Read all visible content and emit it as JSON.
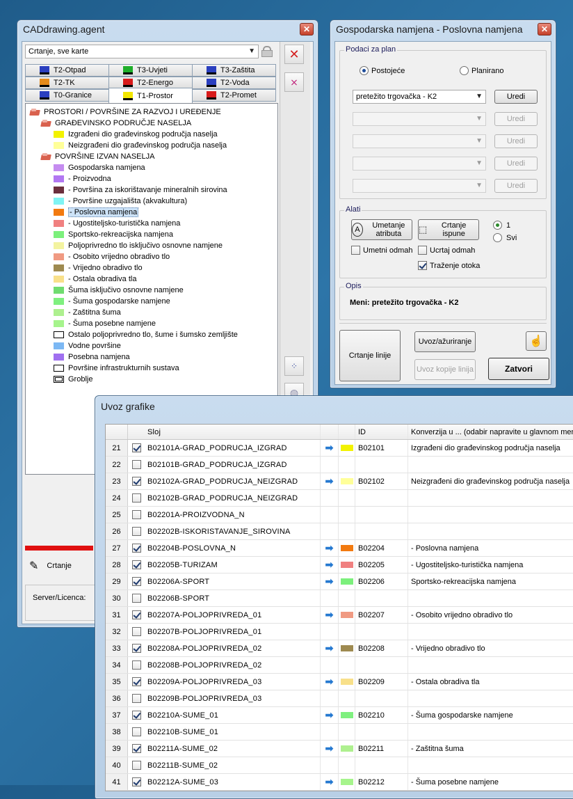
{
  "cad": {
    "title": "CADdrawing.agent",
    "dropdown_value": "Crtanje, sve karte",
    "tabs_row1": [
      {
        "label": "T2-Otpad",
        "color": "#2b3fbf"
      },
      {
        "label": "T3-Uvjeti",
        "color": "#1fae2a"
      },
      {
        "label": "T3-Zaštita",
        "color": "#2b3fbf"
      }
    ],
    "tabs_row2": [
      {
        "label": "T2-TK",
        "color": "#e58b1c"
      },
      {
        "label": "T2-Energo",
        "color": "#d81b1b"
      },
      {
        "label": "T2-Voda",
        "color": "#2b3fbf"
      }
    ],
    "tabs_row3": [
      {
        "label": "T0-Granice",
        "color": "#2b3fbf"
      },
      {
        "label": "T1-Prostor",
        "color": "#f2e600"
      },
      {
        "label": "T2-Promet",
        "color": "#d81b1b"
      }
    ],
    "tree": [
      {
        "level": 0,
        "folder": true,
        "label": "PROSTORI / POVRŠINE ZA RAZVOJ I UREĐENJE"
      },
      {
        "level": 1,
        "folder": true,
        "label": "GRAĐEVINSKO PODRUČJE NASELJA"
      },
      {
        "level": 2,
        "color": "#f2f200",
        "label": "Izgrađeni dio građevinskog područja naselja"
      },
      {
        "level": 2,
        "color": "#ffff99",
        "label": "Neizgrađeni dio građevinskog područja naselja"
      },
      {
        "level": 1,
        "folder": true,
        "label": "POVRŠINE IZVAN NASELJA"
      },
      {
        "level": 2,
        "color": "#c58cf0",
        "label": "Gospodarska namjena"
      },
      {
        "level": 2,
        "color": "#b277f2",
        "label": "- Proizvodna"
      },
      {
        "level": 2,
        "color": "#6b2f3d",
        "label": "- Površina za iskorištavanje mineralnih sirovina"
      },
      {
        "level": 2,
        "color": "#7ff4f4",
        "label": "- Površine uzgajališta (akvakultura)"
      },
      {
        "level": 2,
        "color": "#f27a10",
        "label": "- Poslovna namjena",
        "selected": true
      },
      {
        "level": 2,
        "color": "#f08080",
        "label": "- Ugostiteljsko-turistička namjena"
      },
      {
        "level": 2,
        "color": "#7cf07c",
        "label": "Sportsko-rekreacijska namjena"
      },
      {
        "level": 2,
        "color": "#f3f3a0",
        "label": "Poljoprivredno tlo isključivo osnovne namjene"
      },
      {
        "level": 2,
        "color": "#f09a82",
        "label": "- Osobito vrijedno obradivo tlo"
      },
      {
        "level": 2,
        "color": "#9e8a50",
        "label": "- Vrijedno obradivo tlo"
      },
      {
        "level": 2,
        "color": "#f8e08a",
        "label": "- Ostala obradiva tla"
      },
      {
        "level": 2,
        "color": "#6fdc6f",
        "label": "Šuma isključivo osnovne namjene"
      },
      {
        "level": 2,
        "color": "#7ff07f",
        "label": "- Šuma gospodarske namjene"
      },
      {
        "level": 2,
        "color": "#aef08f",
        "label": "- Zaštitna šuma"
      },
      {
        "level": 2,
        "color": "#a6f48c",
        "label": "- Šuma posebne namjene"
      },
      {
        "level": 2,
        "outline": "single",
        "label": "Ostalo poljoprivredno tlo, šume i šumsko zemljište"
      },
      {
        "level": 2,
        "color": "#7cb8f4",
        "label": "Vodne površine"
      },
      {
        "level": 2,
        "color": "#a070f0",
        "label": "Posebna namjena"
      },
      {
        "level": 2,
        "outline": "single",
        "label": "Površine infrastrukturnih sustava"
      },
      {
        "level": 2,
        "outline": "double",
        "label": "Groblje"
      }
    ],
    "bottom_label": "Crtanje",
    "server_label": "Server/Licenca:"
  },
  "gosp": {
    "title": "Gospodarska namjena - Poslovna namjena",
    "group_podaci": "Podaci za plan",
    "radio_postojece": "Postojeće",
    "radio_planirano": "Planirano",
    "combo_main": "pretežito trgovačka - K2",
    "uredi": "Uredi",
    "group_alati": "Alati",
    "btn_umetanje": "Umetanje atributa",
    "btn_crtanje_ispune": "Crtanje ispune",
    "radio_1": "1",
    "radio_svi": "Svi",
    "chk_umetni": "Umetni odmah",
    "chk_ucrtaj": "Ucrtaj odmah",
    "chk_trazenje": "Traženje otoka",
    "group_opis": "Opis",
    "opis_text": "Meni: pretežito trgovačka - K2",
    "btn_crtanje_linije": "Crtanje linije",
    "btn_uvoz": "Uvoz/ažuriranje",
    "btn_uvoz_kopije": "Uvoz kopije linija",
    "btn_zatvori": "Zatvori"
  },
  "uvoz": {
    "title": "Uvoz grafike",
    "headers": {
      "sloj": "Sloj",
      "id": "ID",
      "konverzija": "Konverzija u ... (odabir napravite u glavnom meniju)"
    },
    "rows": [
      {
        "num": "21",
        "checked": true,
        "sloj": "B02101A-GRAD_PODRUCJA_IZGRAD",
        "arrow": true,
        "color": "#f2f200",
        "id": "B02101",
        "conv": "Izgrađeni dio građevinskog područja naselja"
      },
      {
        "num": "22",
        "checked": false,
        "sloj": "B02101B-GRAD_PODRUCJA_IZGRAD",
        "arrow": false,
        "color": "",
        "id": "",
        "conv": ""
      },
      {
        "num": "23",
        "checked": true,
        "sloj": "B02102A-GRAD_PODRUCJA_NEIZGRAD",
        "arrow": true,
        "color": "#ffff99",
        "id": "B02102",
        "conv": "Neizgrađeni dio građevinskog područja naselja"
      },
      {
        "num": "24",
        "checked": false,
        "sloj": "B02102B-GRAD_PODRUCJA_NEIZGRAD",
        "arrow": false,
        "color": "",
        "id": "",
        "conv": ""
      },
      {
        "num": "25",
        "checked": false,
        "sloj": "B02201A-PROIZVODNA_N",
        "arrow": false,
        "color": "",
        "id": "",
        "conv": ""
      },
      {
        "num": "26",
        "checked": false,
        "sloj": "B02202B-ISKORISTAVANJE_SIROVINA",
        "arrow": false,
        "color": "",
        "id": "",
        "conv": ""
      },
      {
        "num": "27",
        "checked": true,
        "sloj": "B02204B-POSLOVNA_N",
        "arrow": true,
        "color": "#f27a10",
        "id": "B02204",
        "conv": "- Poslovna namjena"
      },
      {
        "num": "28",
        "checked": true,
        "sloj": "B02205B-TURIZAM",
        "arrow": true,
        "color": "#f08080",
        "id": "B02205",
        "conv": "- Ugostiteljsko-turistička namjena"
      },
      {
        "num": "29",
        "checked": true,
        "sloj": "B02206A-SPORT",
        "arrow": true,
        "color": "#7cf07c",
        "id": "B02206",
        "conv": "Sportsko-rekreacijska namjena"
      },
      {
        "num": "30",
        "checked": false,
        "sloj": "B02206B-SPORT",
        "arrow": false,
        "color": "",
        "id": "",
        "conv": ""
      },
      {
        "num": "31",
        "checked": true,
        "sloj": "B02207A-POLJOPRIVREDA_01",
        "arrow": true,
        "color": "#f09a82",
        "id": "B02207",
        "conv": "- Osobito vrijedno obradivo tlo"
      },
      {
        "num": "32",
        "checked": false,
        "sloj": "B02207B-POLJOPRIVREDA_01",
        "arrow": false,
        "color": "",
        "id": "",
        "conv": ""
      },
      {
        "num": "33",
        "checked": true,
        "sloj": "B02208A-POLJOPRIVREDA_02",
        "arrow": true,
        "color": "#9e8a50",
        "id": "B02208",
        "conv": "- Vrijedno obradivo tlo"
      },
      {
        "num": "34",
        "checked": false,
        "sloj": "B02208B-POLJOPRIVREDA_02",
        "arrow": false,
        "color": "",
        "id": "",
        "conv": ""
      },
      {
        "num": "35",
        "checked": true,
        "sloj": "B02209A-POLJOPRIVREDA_03",
        "arrow": true,
        "color": "#f8e08a",
        "id": "B02209",
        "conv": "- Ostala obradiva tla"
      },
      {
        "num": "36",
        "checked": false,
        "sloj": "B02209B-POLJOPRIVREDA_03",
        "arrow": false,
        "color": "",
        "id": "",
        "conv": ""
      },
      {
        "num": "37",
        "checked": true,
        "sloj": "B02210A-SUME_01",
        "arrow": true,
        "color": "#7ff07f",
        "id": "B02210",
        "conv": "- Šuma gospodarske namjene"
      },
      {
        "num": "38",
        "checked": false,
        "sloj": "B02210B-SUME_01",
        "arrow": false,
        "color": "",
        "id": "",
        "conv": ""
      },
      {
        "num": "39",
        "checked": true,
        "sloj": "B02211A-SUME_02",
        "arrow": true,
        "color": "#aef08f",
        "id": "B02211",
        "conv": "- Zaštitna šuma"
      },
      {
        "num": "40",
        "checked": false,
        "sloj": "B02211B-SUME_02",
        "arrow": false,
        "color": "",
        "id": "",
        "conv": ""
      },
      {
        "num": "41",
        "checked": true,
        "sloj": "B02212A-SUME_03",
        "arrow": true,
        "color": "#a6f48c",
        "id": "B02212",
        "conv": "- Šuma posebne namjene"
      }
    ]
  }
}
